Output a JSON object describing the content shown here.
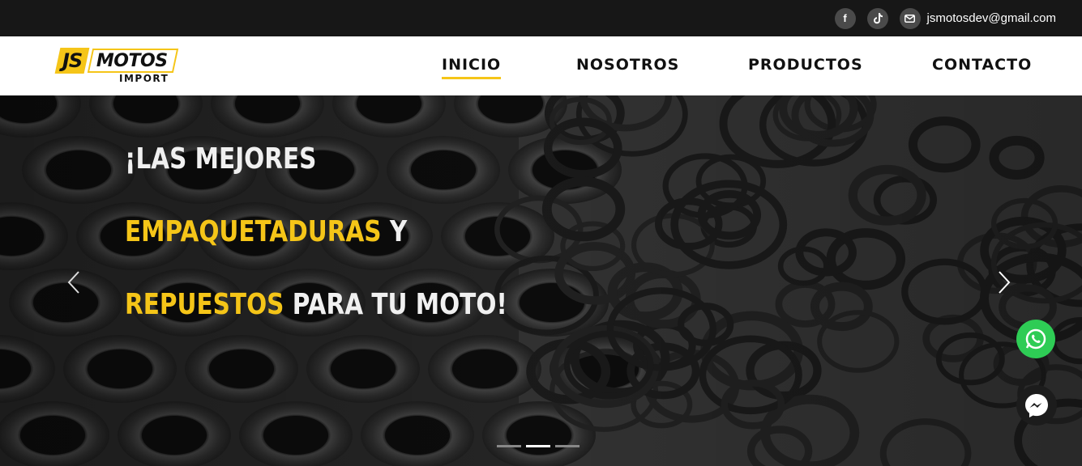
{
  "topbar": {
    "facebook_icon": "f",
    "tiktok_icon": "♪",
    "email": "jsmotosdev@gmail.com"
  },
  "logo": {
    "js": "JS",
    "motos": "MOTOS",
    "import": "IMPORT"
  },
  "nav": {
    "items": [
      {
        "label": "INICIO",
        "active": true
      },
      {
        "label": "NOSOTROS",
        "active": false
      },
      {
        "label": "PRODUCTOS",
        "active": false
      },
      {
        "label": "CONTACTO",
        "active": false
      }
    ]
  },
  "hero": {
    "line1": "¡LAS MEJORES",
    "line2_highlight": "EMPAQUETADURAS",
    "line2_rest": " Y",
    "line3_highlight": "REPUESTOS",
    "line3_rest": " PARA TU MOTO!",
    "slides": 3,
    "active_slide": 2
  },
  "colors": {
    "accent": "#f5c518",
    "topbar": "#171717",
    "whatsapp": "#2ecc55"
  }
}
